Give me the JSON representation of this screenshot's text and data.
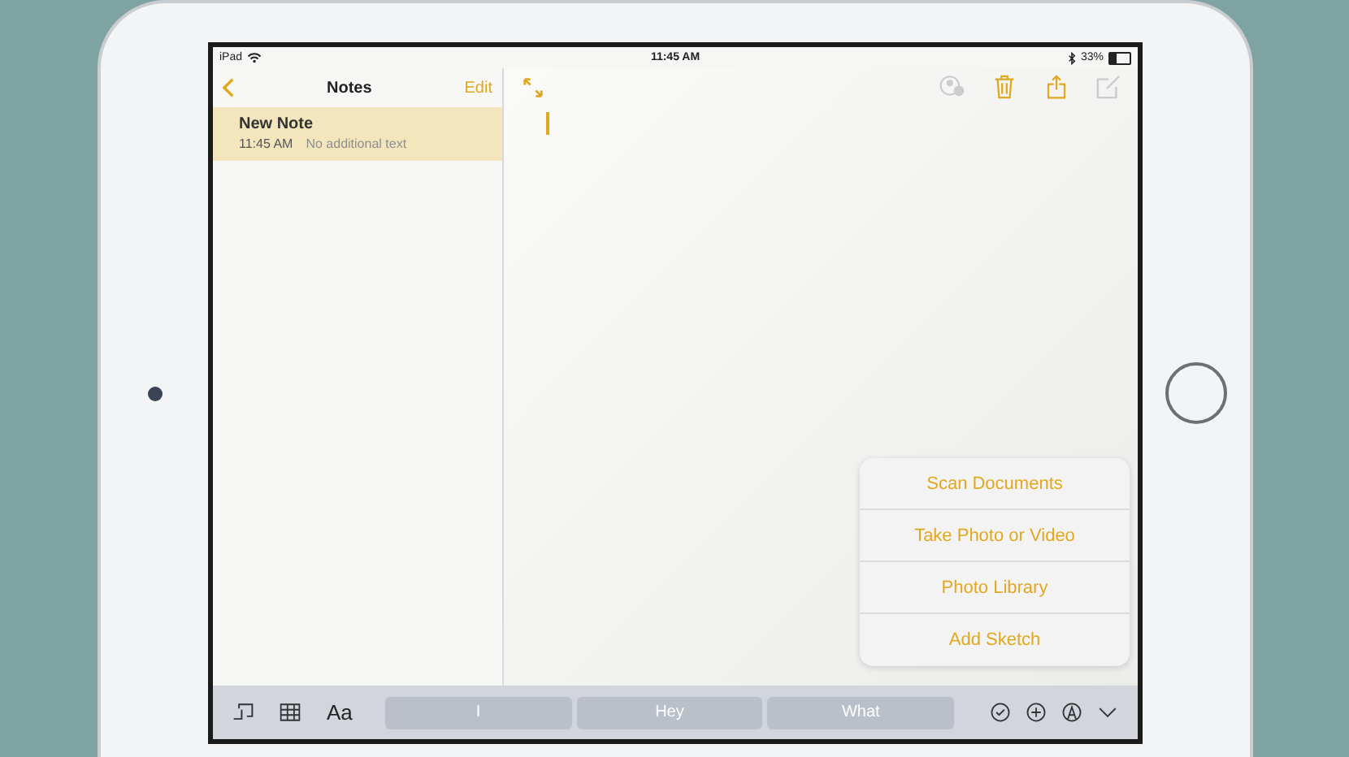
{
  "status_bar": {
    "device": "iPad",
    "time": "11:45 AM",
    "battery": "33%"
  },
  "sidebar": {
    "title": "Notes",
    "edit_label": "Edit",
    "notes": [
      {
        "title": "New Note",
        "time": "11:45 AM",
        "preview": "No additional text",
        "selected": true
      }
    ]
  },
  "popover": {
    "items": [
      "Scan Documents",
      "Take Photo or Video",
      "Photo Library",
      "Add Sketch"
    ]
  },
  "keyboard_bar": {
    "suggestions": [
      "I",
      "Hey",
      "What"
    ],
    "text_style_label": "Aa"
  }
}
